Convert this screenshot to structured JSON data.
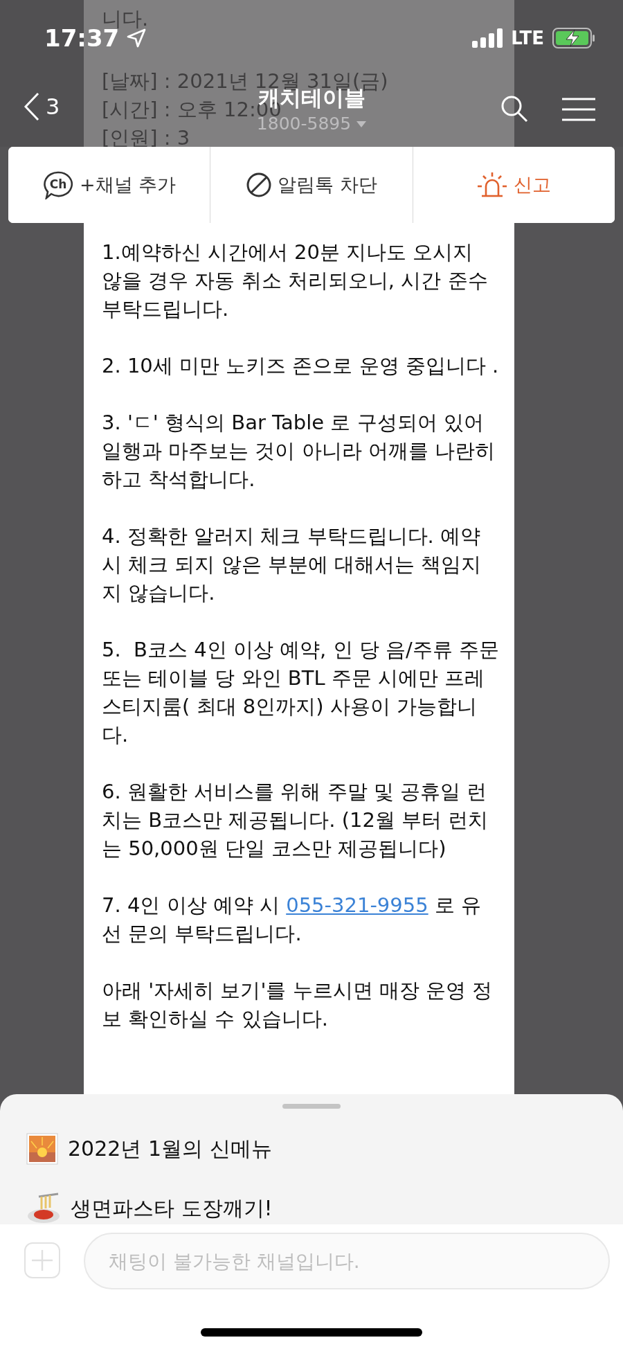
{
  "status_bar": {
    "time": "17:37",
    "network": "LTE"
  },
  "header": {
    "back_count": "3",
    "title": "캐치테이블",
    "phone": "1800-5895"
  },
  "actions": [
    {
      "kind": "add_channel",
      "icon_text": "Ch",
      "label": "+채널 추가"
    },
    {
      "kind": "block",
      "label": "알림톡 차단"
    },
    {
      "kind": "report",
      "label": "신고"
    }
  ],
  "message": {
    "intro": [
      "니다."
    ],
    "details": [
      "[날짜] : 2021년 12월 31일(금)",
      "[시간] : 오후 12:00",
      "[인원] : 3"
    ],
    "notes": [
      {
        "text": "1.예약하신 시간에서 20분 지나도 오시지 않을 경우 자동 취소 처리되오니, 시간 준수 부탁드립니다."
      },
      {
        "text": "2. 10세 미만 노키즈 존으로 운영 중입니다 ."
      },
      {
        "text": "3. 'ㄷ' 형식의 Bar Table 로 구성되어 있어 일행과 마주보는 것이 아니라 어깨를 나란히 하고 착석합니다."
      },
      {
        "text": "4. 정확한 알러지 체크 부탁드립니다. 예약시 체크 되지 않은 부분에 대해서는 책임지지 않습니다."
      },
      {
        "text": "5.  B코스 4인 이상 예약, 인 당 음/주류 주문 또는 테이블 당 와인 BTL 주문 시에만 프레스티지룸( 최대 8인까지) 사용이 가능합니다."
      },
      {
        "text": "6. 원활한 서비스를 위해 주말 및 공휴일 런치는 B코스만 제공됩니다. (12월 부터 런치는 50,000원 단일 코스만 제공됩니다)"
      },
      {
        "text": "7. 4인 이상 예약 시 ",
        "link": "055-321-9955",
        "after": " 로 유선 문의 부탁드립니다."
      },
      {
        "text": "아래 '자세히 보기'를 누르시면 매장 운영 정보 확인하실 수 있습니다."
      }
    ]
  },
  "sheet": {
    "items": [
      {
        "kind": "sunset",
        "label": "2022년 1월의 신메뉴"
      },
      {
        "kind": "pasta",
        "label": "생면파스타 도장깨기!"
      }
    ]
  },
  "composer": {
    "placeholder": "채팅이 불가능한 채널입니다.",
    "disabled": true
  }
}
